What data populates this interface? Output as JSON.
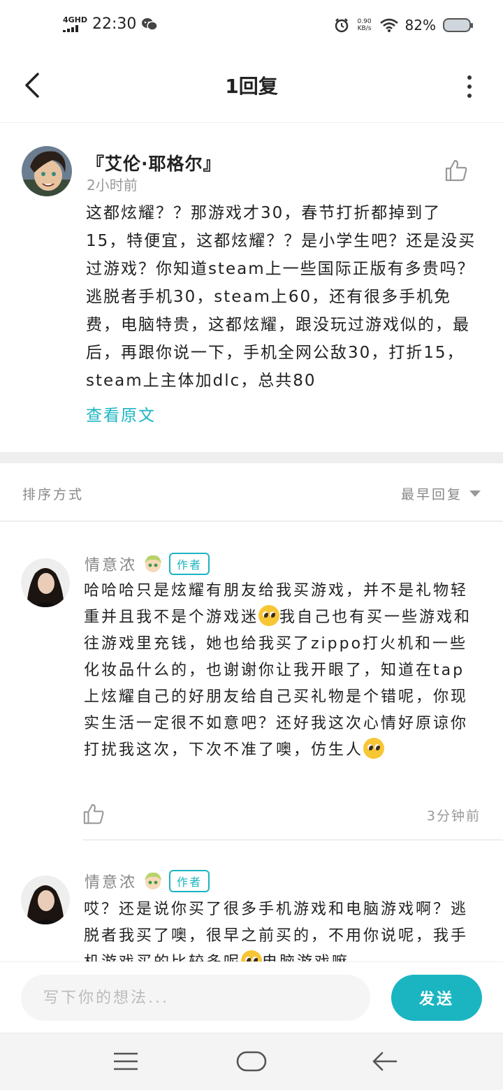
{
  "status_bar": {
    "network": "4GHD",
    "time": "22:30",
    "net_speed": "0.90",
    "net_speed_unit": "KB/s",
    "battery": "82%",
    "icons": [
      "signal-icon",
      "wechat-icon",
      "alarm-icon",
      "wifi-icon",
      "battery-icon"
    ]
  },
  "header": {
    "title": "1回复",
    "back_icon": "chevron-left-icon",
    "more_icon": "more-vertical-icon"
  },
  "post": {
    "author": "『艾伦·耶格尔』",
    "time": "2小时前",
    "body": "这都炫耀？？那游戏才30，春节打折都掉到了15，特便宜，这都炫耀？？是小学生吧？还是没买过游戏？你知道steam上一些国际正版有多贵吗？逃脱者手机30，steam上60，还有很多手机免费，电脑特贵，这都炫耀，跟没玩过游戏似的，最后，再跟你说一下，手机全网公敌30，打折15，steam上主体加dlc，总共80",
    "view_original": "查看原文"
  },
  "sort": {
    "label": "排序方式",
    "selected": "最早回复"
  },
  "replies": [
    {
      "author": "情意浓",
      "badge": "作者",
      "body_parts": [
        "哈哈哈只是炫耀有朋友给我买游戏，并不是礼物轻重并且我不是个游戏迷",
        "我自己也有买一些游戏和往游戏里充钱，她也给我买了zippo打火机和一些化妆品什么的，也谢谢你让我开眼了，知道在tap上炫耀自己的好朋友给自己买礼物是个错呢，你现实生活一定很不如意吧？还好我这次心情好原谅你打扰我这次，下次不准了噢，仿生人",
        ""
      ],
      "time": "3分钟前"
    },
    {
      "author": "情意浓",
      "badge": "作者",
      "body_parts": [
        "哎？还是说你买了很多手机游戏和电脑游戏啊？逃脱者我买了噢，很早之前买的，不用你说呢，我手机游戏买的比较多呢",
        "电脑游戏嘛"
      ]
    }
  ],
  "composer": {
    "placeholder": "写下你的想法...",
    "send_label": "发送"
  },
  "colors": {
    "accent": "#1bb5c2",
    "divider": "#eeeeee",
    "muted_text": "#999999"
  }
}
